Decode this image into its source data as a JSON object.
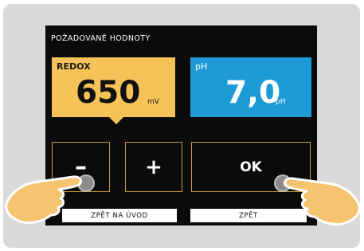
{
  "screen": {
    "title": "POŽADOVANÉ HODNOTY"
  },
  "redox": {
    "label": "REDOX",
    "value": "650",
    "unit": "mV",
    "color": "#f7c358"
  },
  "ph": {
    "label": "pH",
    "value": "7,0",
    "unit": "pH",
    "color": "#1e9ad6"
  },
  "keys": {
    "minus": "–",
    "plus": "+",
    "ok": "OK"
  },
  "footer": {
    "home_label": "ZPĚT NA ÚVOD",
    "back_label": "ZPĚT"
  },
  "icons": {
    "touch_left": "touch-point-icon",
    "touch_right": "touch-point-icon",
    "hand_left": "pointing-hand-icon",
    "hand_right": "pointing-hand-icon"
  }
}
